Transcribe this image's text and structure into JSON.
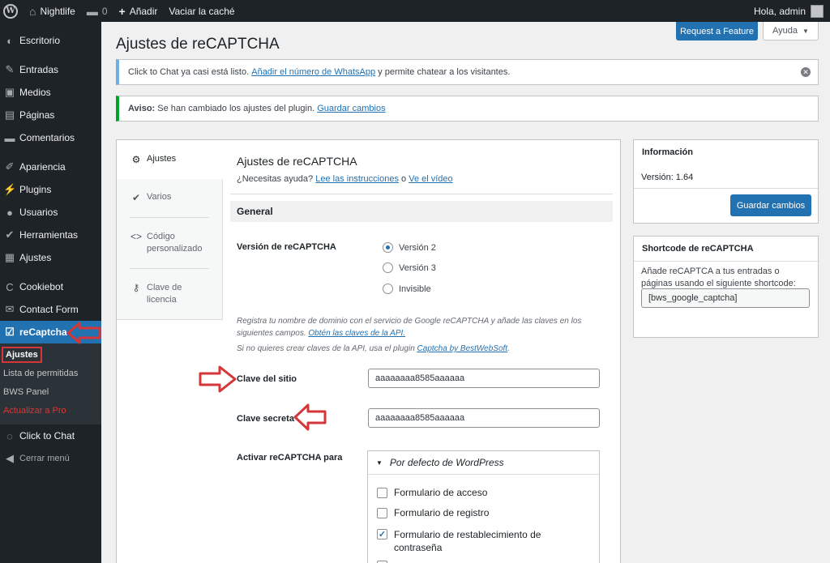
{
  "adminbar": {
    "site_name": "Nightlife",
    "comments_count": "0",
    "new_label": "Añadir",
    "cache_label": "Vaciar la caché",
    "greeting": "Hola, admin"
  },
  "sidebar": {
    "items": [
      {
        "label": "Escritorio",
        "icon": "dashboard-icon"
      },
      {
        "label": "Entradas",
        "icon": "pin-icon"
      },
      {
        "label": "Medios",
        "icon": "media-icon"
      },
      {
        "label": "Páginas",
        "icon": "page-icon"
      },
      {
        "label": "Comentarios",
        "icon": "comment-icon"
      },
      {
        "label": "Apariencia",
        "icon": "brush-icon"
      },
      {
        "label": "Plugins",
        "icon": "plugin-icon"
      },
      {
        "label": "Usuarios",
        "icon": "user-icon"
      },
      {
        "label": "Herramientas",
        "icon": "wrench-icon"
      },
      {
        "label": "Ajustes",
        "icon": "settings-icon"
      },
      {
        "label": "Cookiebot",
        "icon": "cookiebot-icon"
      },
      {
        "label": "Contact Form",
        "icon": "mail-icon"
      },
      {
        "label": "reCaptcha",
        "icon": "checkbox-icon"
      },
      {
        "label": "Click to Chat",
        "icon": "whatsapp-icon"
      },
      {
        "label": "Cerrar menú",
        "icon": "collapse-icon"
      }
    ],
    "submenu": [
      "Ajustes",
      "Lista de permitidas",
      "BWS Panel",
      "Actualizar a Pro"
    ]
  },
  "header": {
    "title": "Ajustes de reCAPTCHA",
    "feature_button": "Request a Feature",
    "help_button": "Ayuda"
  },
  "notices": {
    "info_text_before": "Click to Chat ya casi está listo.",
    "info_link": "Añadir el número de WhatsApp",
    "info_text_after": "y permite chatear a los visitantes.",
    "success_label": "Aviso:",
    "success_text": "Se han cambiado los ajustes del plugin.",
    "success_link": "Guardar cambios"
  },
  "tabs": [
    {
      "label": "Ajustes",
      "icon": "gear-icon"
    },
    {
      "label": "Varios",
      "icon": "wrench-icon"
    },
    {
      "label": "Código personalizado",
      "icon": "code-icon"
    },
    {
      "label": "Clave de licencia",
      "icon": "key-icon"
    }
  ],
  "content": {
    "title": "Ajustes de reCAPTCHA",
    "help_prefix": "¿Necesitas ayuda?",
    "help_link1": "Lee las instrucciones",
    "help_or": "o",
    "help_link2": "Ve el vídeo",
    "general": "General",
    "version_label": "Versión de reCAPTCHA",
    "versions": [
      {
        "label": "Versión 2",
        "checked": true
      },
      {
        "label": "Versión 3",
        "checked": false
      },
      {
        "label": "Invisible",
        "checked": false
      }
    ],
    "desc1_text": "Registra tu nombre de dominio con el servicio de Google reCAPTCHA y añade las claves en los siguientes campos.",
    "desc1_link": "Obtén las claves de la API.",
    "desc2_text": "Si no quieres crear claves de la API, usa el plugin",
    "desc2_link": "Captcha by BestWebSoft",
    "site_key_label": "Clave del sitio",
    "site_key_value": "aaaaaaaa8585aaaaaa",
    "secret_key_label": "Clave secreta",
    "secret_key_value": "aaaaaaaa8585aaaaaa",
    "activate_label": "Activar reCAPTCHA para",
    "accordion_title": "Por defecto de WordPress",
    "checkboxes": [
      {
        "label": "Formulario de acceso",
        "checked": false
      },
      {
        "label": "Formulario de registro",
        "checked": false
      },
      {
        "label": "Formulario de restablecimiento de contraseña",
        "checked": true
      }
    ]
  },
  "info_box": {
    "title": "Información",
    "version": "Versión: 1.64",
    "save_button": "Guardar cambios"
  },
  "shortcode_box": {
    "title": "Shortcode de reCAPTCHA",
    "text": "Añade reCAPTCA a tus entradas o páginas usando el siguiente shortcode:",
    "shortcode": "[bws_google_captcha]"
  },
  "colors": {
    "accent": "#2271b1",
    "annotation": "#d63638",
    "admin_dark": "#1d2327"
  }
}
